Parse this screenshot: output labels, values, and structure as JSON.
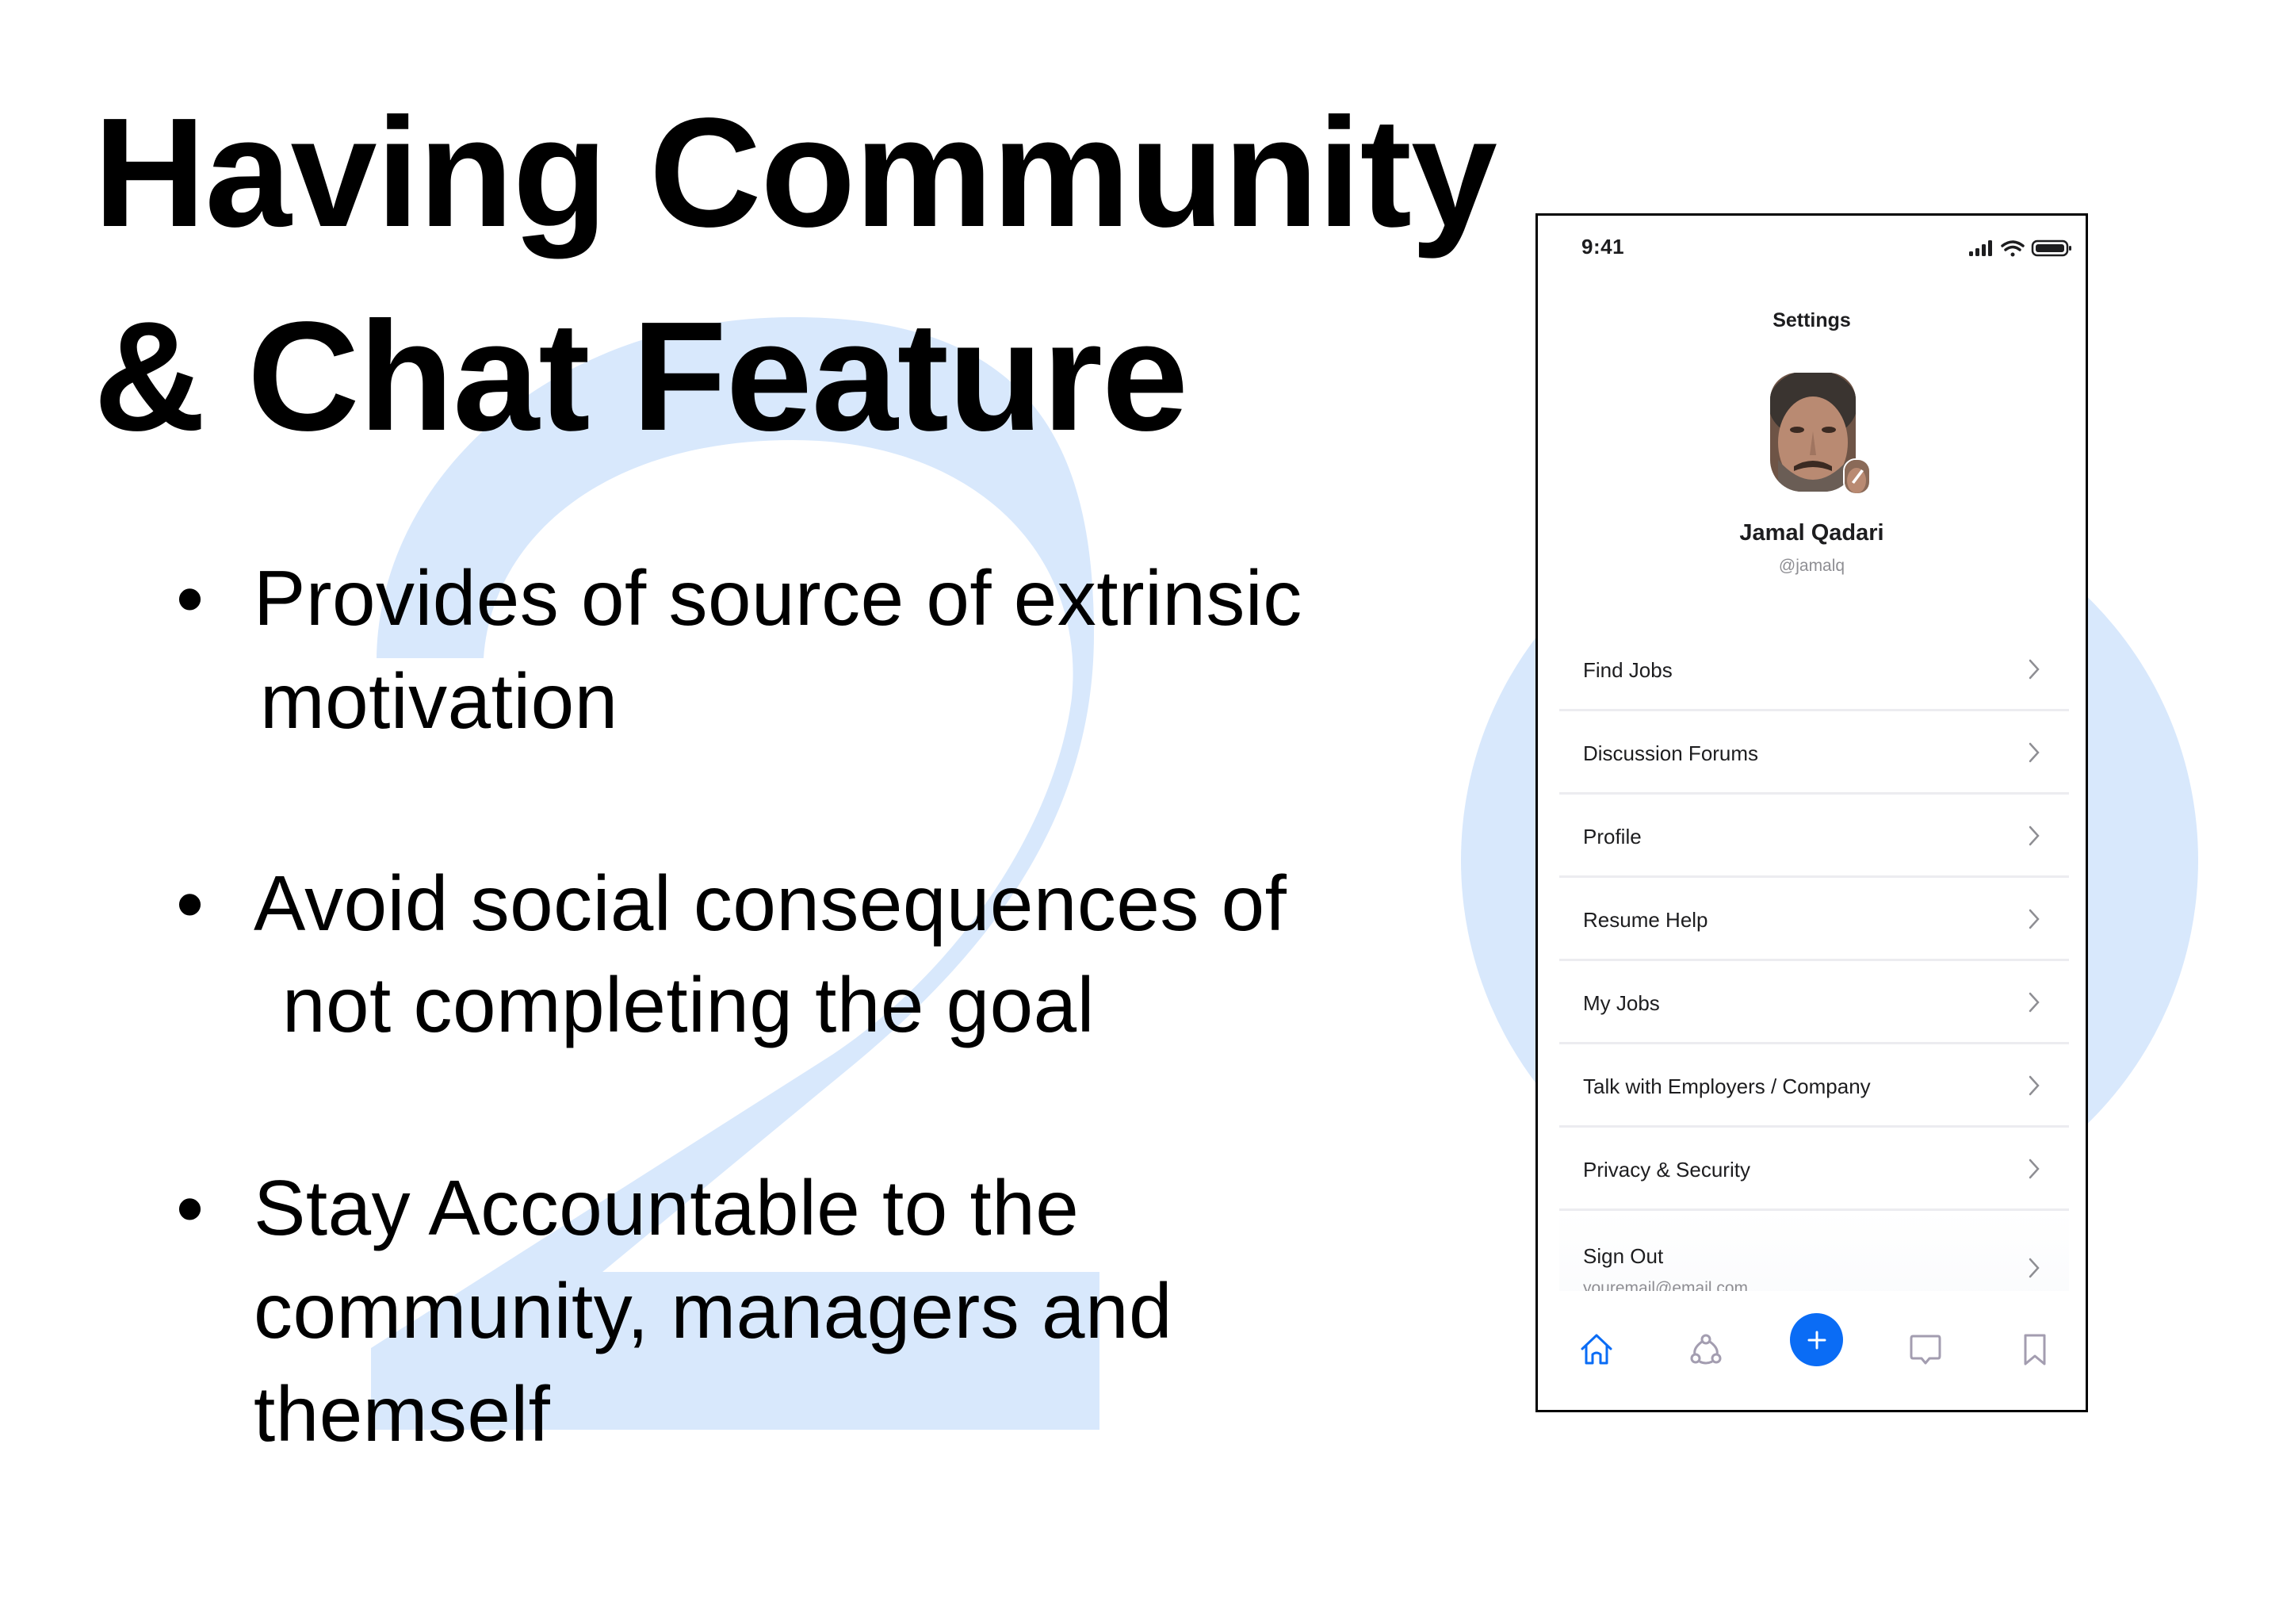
{
  "slide": {
    "title_lines": [
      "Having Community",
      "& Chat Feature"
    ],
    "background_numeral": "2",
    "bullets": [
      {
        "lines": [
          "Provides of source of extrinsic",
          "motivation"
        ]
      },
      {
        "lines": [
          "Avoid social consequences of",
          "not completing the goal"
        ]
      },
      {
        "lines": [
          "Stay Accountable to the",
          "community,  managers and",
          "themself"
        ]
      }
    ],
    "colors": {
      "accent_light": "#D8E8FC",
      "text": "#000000"
    }
  },
  "phone": {
    "status_bar": {
      "time": "9:41",
      "icons": [
        "signal-icon",
        "wifi-icon",
        "battery-icon"
      ]
    },
    "screen_title": "Settings",
    "profile": {
      "name": "Jamal Qadari",
      "handle": "@jamalq",
      "avatar_badge_icon": "edit-pencil-icon"
    },
    "menu": [
      {
        "label": "Find Jobs"
      },
      {
        "label": "Discussion Forums"
      },
      {
        "label": "Profile"
      },
      {
        "label": "Resume Help"
      },
      {
        "label": "My Jobs"
      },
      {
        "label": "Talk with Employers / Company"
      },
      {
        "label": "Privacy & Security"
      },
      {
        "label": "Sign Out",
        "sublabel": "youremail@email.com"
      }
    ],
    "bottom_nav": [
      {
        "icon": "home-icon",
        "active": true
      },
      {
        "icon": "community-icon",
        "active": false
      },
      {
        "icon": "add-icon",
        "primary": true
      },
      {
        "icon": "chat-icon",
        "active": false
      },
      {
        "icon": "bookmark-icon",
        "active": false
      }
    ],
    "colors": {
      "primary": "#0A6CF5",
      "inactive_icon": "#A39DB0",
      "text": "#1D1D1F",
      "muted": "#8E8E93"
    }
  }
}
